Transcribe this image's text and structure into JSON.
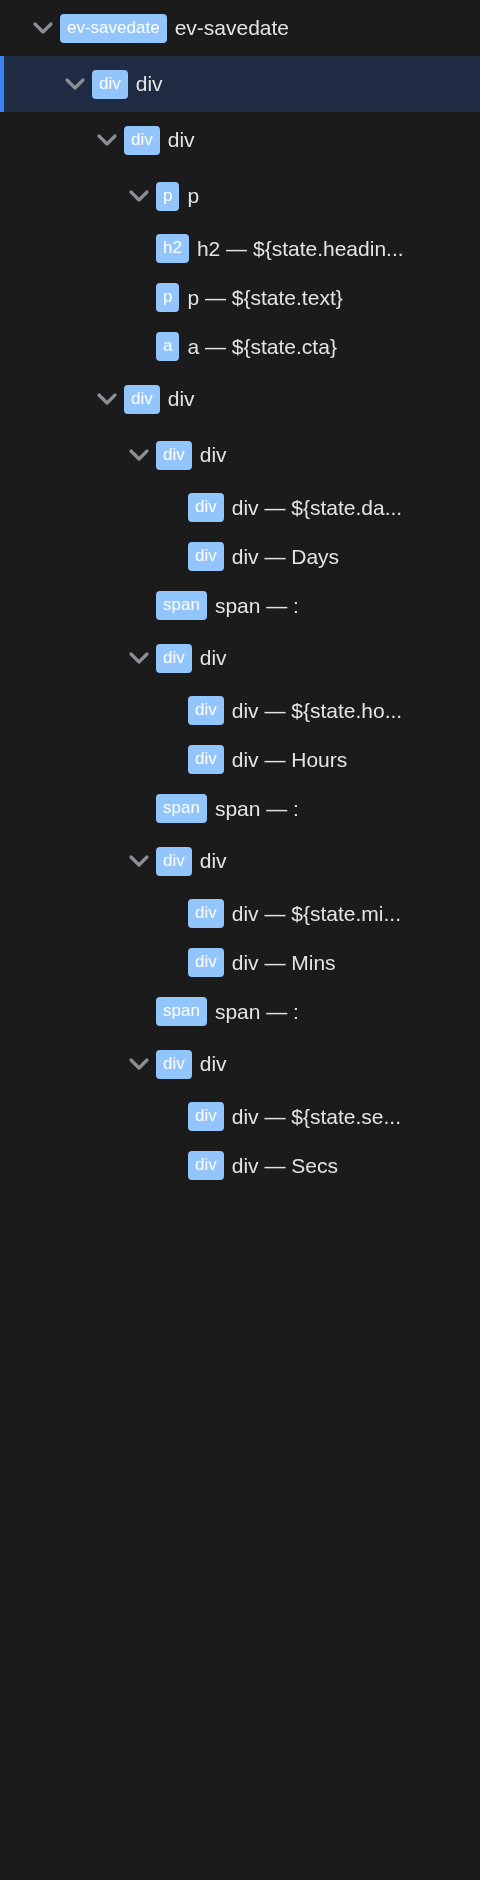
{
  "tree": [
    {
      "tag": "ev-savedate",
      "label": "ev-savedate",
      "expanded": true,
      "selected": false,
      "children": [
        {
          "tag": "div",
          "label": "div",
          "expanded": true,
          "selected": true,
          "children": [
            {
              "tag": "div",
              "label": "div",
              "expanded": true,
              "selected": false,
              "children": [
                {
                  "tag": "p",
                  "label": "p",
                  "expanded": true,
                  "selected": false
                },
                {
                  "tag": "h2",
                  "label": "h2 — ${state.headin...",
                  "selected": false
                },
                {
                  "tag": "p",
                  "label": "p — ${state.text}",
                  "selected": false
                },
                {
                  "tag": "a",
                  "label": "a — ${state.cta}",
                  "selected": false
                }
              ]
            },
            {
              "tag": "div",
              "label": "div",
              "expanded": true,
              "selected": false,
              "children": [
                {
                  "tag": "div",
                  "label": "div",
                  "expanded": true,
                  "selected": false,
                  "children": [
                    {
                      "tag": "div",
                      "label": "div — ${state.da...",
                      "selected": false
                    },
                    {
                      "tag": "div",
                      "label": "div — Days",
                      "selected": false
                    }
                  ]
                },
                {
                  "tag": "span",
                  "label": "span — :",
                  "selected": false
                },
                {
                  "tag": "div",
                  "label": "div",
                  "expanded": true,
                  "selected": false,
                  "children": [
                    {
                      "tag": "div",
                      "label": "div — ${state.ho...",
                      "selected": false
                    },
                    {
                      "tag": "div",
                      "label": "div — Hours",
                      "selected": false
                    }
                  ]
                },
                {
                  "tag": "span",
                  "label": "span — :",
                  "selected": false
                },
                {
                  "tag": "div",
                  "label": "div",
                  "expanded": true,
                  "selected": false,
                  "children": [
                    {
                      "tag": "div",
                      "label": "div — ${state.mi...",
                      "selected": false
                    },
                    {
                      "tag": "div",
                      "label": "div — Mins",
                      "selected": false
                    }
                  ]
                },
                {
                  "tag": "span",
                  "label": "span — :",
                  "selected": false
                },
                {
                  "tag": "div",
                  "label": "div",
                  "expanded": true,
                  "selected": false,
                  "children": [
                    {
                      "tag": "div",
                      "label": "div — ${state.se...",
                      "selected": false
                    },
                    {
                      "tag": "div",
                      "label": "div — Secs",
                      "selected": false
                    }
                  ]
                }
              ]
            }
          ]
        }
      ]
    }
  ]
}
